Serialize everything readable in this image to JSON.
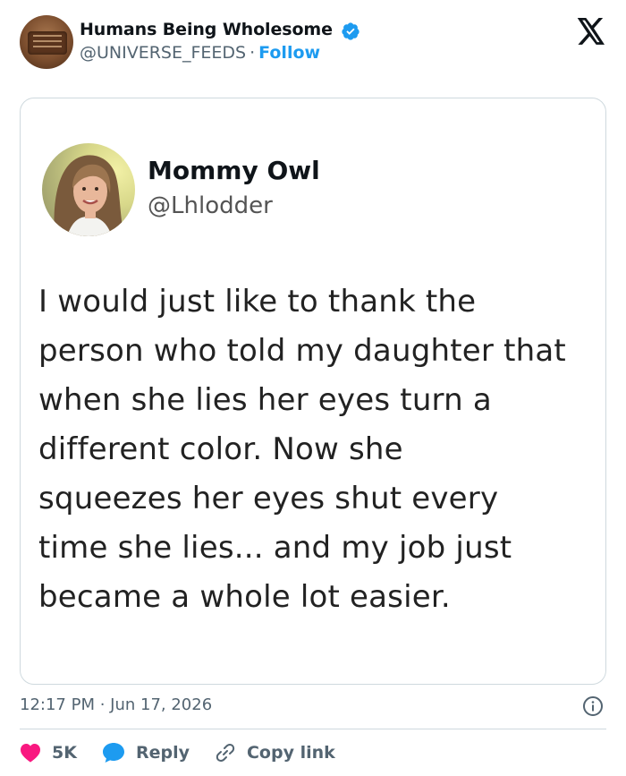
{
  "header": {
    "account_name": "Humans Being Wholesome",
    "handle": "@UNIVERSE_FEEDS",
    "separator": "·",
    "follow_label": "Follow",
    "avatar_icon": "plaque-photo-avatar",
    "verified_icon": "verified-badge-icon",
    "platform_icon": "x-logo-icon"
  },
  "embedded_tweet": {
    "name": "Mommy Owl",
    "handle": "@Lhlodder",
    "lines": [
      "I would just like to thank the",
      "person who told my daughter that",
      "when she lies her eyes turn a",
      "different color. Now she",
      "squeezes her eyes shut every",
      "time she lies... and my job just",
      "became a whole lot easier."
    ]
  },
  "footer": {
    "timestamp": "12:17 PM · Jun 17, 2026",
    "likes_count": "5K",
    "reply_label": "Reply",
    "copy_link_label": "Copy link"
  },
  "colors": {
    "accent": "#1d9bf0",
    "like": "#f91880",
    "secondary_text": "#536471",
    "border": "#cfd9de"
  }
}
